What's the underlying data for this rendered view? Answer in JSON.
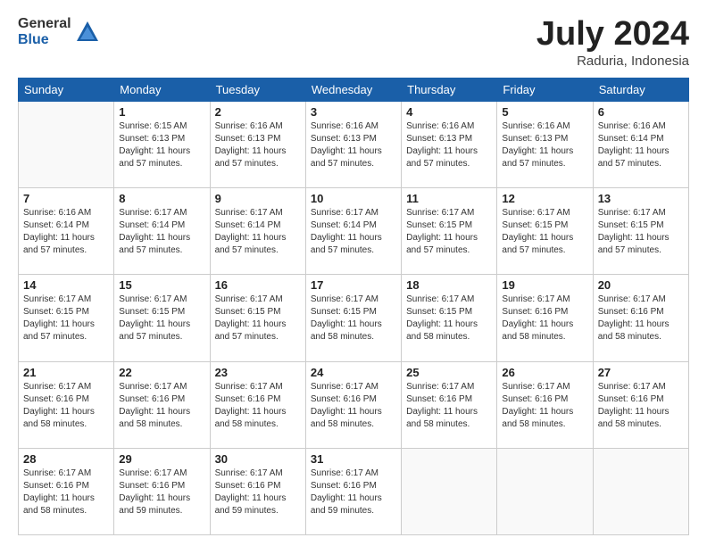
{
  "logo": {
    "general": "General",
    "blue": "Blue"
  },
  "header": {
    "month": "July 2024",
    "location": "Raduria, Indonesia"
  },
  "weekdays": [
    "Sunday",
    "Monday",
    "Tuesday",
    "Wednesday",
    "Thursday",
    "Friday",
    "Saturday"
  ],
  "weeks": [
    [
      {
        "day": "",
        "info": ""
      },
      {
        "day": "1",
        "info": "Sunrise: 6:15 AM\nSunset: 6:13 PM\nDaylight: 11 hours\nand 57 minutes."
      },
      {
        "day": "2",
        "info": "Sunrise: 6:16 AM\nSunset: 6:13 PM\nDaylight: 11 hours\nand 57 minutes."
      },
      {
        "day": "3",
        "info": "Sunrise: 6:16 AM\nSunset: 6:13 PM\nDaylight: 11 hours\nand 57 minutes."
      },
      {
        "day": "4",
        "info": "Sunrise: 6:16 AM\nSunset: 6:13 PM\nDaylight: 11 hours\nand 57 minutes."
      },
      {
        "day": "5",
        "info": "Sunrise: 6:16 AM\nSunset: 6:13 PM\nDaylight: 11 hours\nand 57 minutes."
      },
      {
        "day": "6",
        "info": "Sunrise: 6:16 AM\nSunset: 6:14 PM\nDaylight: 11 hours\nand 57 minutes."
      }
    ],
    [
      {
        "day": "7",
        "info": "Sunrise: 6:16 AM\nSunset: 6:14 PM\nDaylight: 11 hours\nand 57 minutes."
      },
      {
        "day": "8",
        "info": "Sunrise: 6:17 AM\nSunset: 6:14 PM\nDaylight: 11 hours\nand 57 minutes."
      },
      {
        "day": "9",
        "info": "Sunrise: 6:17 AM\nSunset: 6:14 PM\nDaylight: 11 hours\nand 57 minutes."
      },
      {
        "day": "10",
        "info": "Sunrise: 6:17 AM\nSunset: 6:14 PM\nDaylight: 11 hours\nand 57 minutes."
      },
      {
        "day": "11",
        "info": "Sunrise: 6:17 AM\nSunset: 6:15 PM\nDaylight: 11 hours\nand 57 minutes."
      },
      {
        "day": "12",
        "info": "Sunrise: 6:17 AM\nSunset: 6:15 PM\nDaylight: 11 hours\nand 57 minutes."
      },
      {
        "day": "13",
        "info": "Sunrise: 6:17 AM\nSunset: 6:15 PM\nDaylight: 11 hours\nand 57 minutes."
      }
    ],
    [
      {
        "day": "14",
        "info": "Sunrise: 6:17 AM\nSunset: 6:15 PM\nDaylight: 11 hours\nand 57 minutes."
      },
      {
        "day": "15",
        "info": "Sunrise: 6:17 AM\nSunset: 6:15 PM\nDaylight: 11 hours\nand 57 minutes."
      },
      {
        "day": "16",
        "info": "Sunrise: 6:17 AM\nSunset: 6:15 PM\nDaylight: 11 hours\nand 57 minutes."
      },
      {
        "day": "17",
        "info": "Sunrise: 6:17 AM\nSunset: 6:15 PM\nDaylight: 11 hours\nand 58 minutes."
      },
      {
        "day": "18",
        "info": "Sunrise: 6:17 AM\nSunset: 6:15 PM\nDaylight: 11 hours\nand 58 minutes."
      },
      {
        "day": "19",
        "info": "Sunrise: 6:17 AM\nSunset: 6:16 PM\nDaylight: 11 hours\nand 58 minutes."
      },
      {
        "day": "20",
        "info": "Sunrise: 6:17 AM\nSunset: 6:16 PM\nDaylight: 11 hours\nand 58 minutes."
      }
    ],
    [
      {
        "day": "21",
        "info": "Sunrise: 6:17 AM\nSunset: 6:16 PM\nDaylight: 11 hours\nand 58 minutes."
      },
      {
        "day": "22",
        "info": "Sunrise: 6:17 AM\nSunset: 6:16 PM\nDaylight: 11 hours\nand 58 minutes."
      },
      {
        "day": "23",
        "info": "Sunrise: 6:17 AM\nSunset: 6:16 PM\nDaylight: 11 hours\nand 58 minutes."
      },
      {
        "day": "24",
        "info": "Sunrise: 6:17 AM\nSunset: 6:16 PM\nDaylight: 11 hours\nand 58 minutes."
      },
      {
        "day": "25",
        "info": "Sunrise: 6:17 AM\nSunset: 6:16 PM\nDaylight: 11 hours\nand 58 minutes."
      },
      {
        "day": "26",
        "info": "Sunrise: 6:17 AM\nSunset: 6:16 PM\nDaylight: 11 hours\nand 58 minutes."
      },
      {
        "day": "27",
        "info": "Sunrise: 6:17 AM\nSunset: 6:16 PM\nDaylight: 11 hours\nand 58 minutes."
      }
    ],
    [
      {
        "day": "28",
        "info": "Sunrise: 6:17 AM\nSunset: 6:16 PM\nDaylight: 11 hours\nand 58 minutes."
      },
      {
        "day": "29",
        "info": "Sunrise: 6:17 AM\nSunset: 6:16 PM\nDaylight: 11 hours\nand 59 minutes."
      },
      {
        "day": "30",
        "info": "Sunrise: 6:17 AM\nSunset: 6:16 PM\nDaylight: 11 hours\nand 59 minutes."
      },
      {
        "day": "31",
        "info": "Sunrise: 6:17 AM\nSunset: 6:16 PM\nDaylight: 11 hours\nand 59 minutes."
      },
      {
        "day": "",
        "info": ""
      },
      {
        "day": "",
        "info": ""
      },
      {
        "day": "",
        "info": ""
      }
    ]
  ]
}
